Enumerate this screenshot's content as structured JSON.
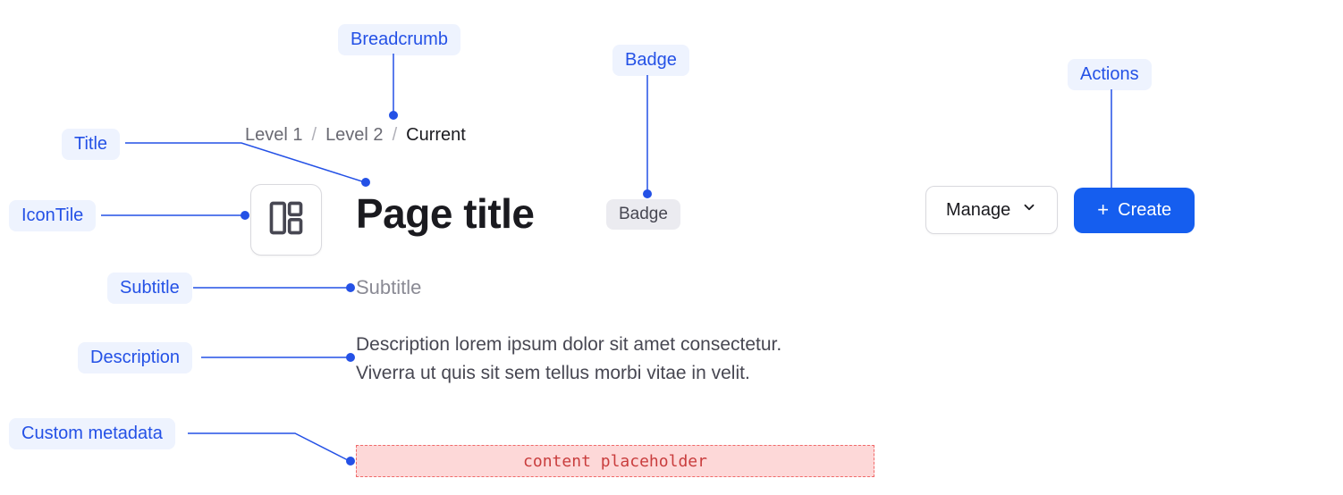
{
  "annotations": {
    "breadcrumb": "Breadcrumb",
    "title": "Title",
    "iconTile": "IconTile",
    "subtitle": "Subtitle",
    "description": "Description",
    "customMetadata": "Custom metadata",
    "badge": "Badge",
    "actions": "Actions"
  },
  "breadcrumb": {
    "level1": "Level 1",
    "level2": "Level 2",
    "current": "Current",
    "separator": "/"
  },
  "header": {
    "page_title": "Page title",
    "badge_label": "Badge",
    "subtitle": "Subtitle",
    "description": "Description lorem ipsum dolor sit amet consectetur. Viverra ut quis sit sem tellus morbi vitae in velit.",
    "content_placeholder": "content placeholder"
  },
  "actions": {
    "manage_label": "Manage",
    "create_label": "Create"
  }
}
